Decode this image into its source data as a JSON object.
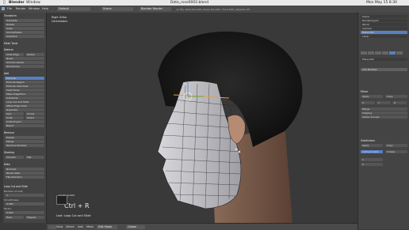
{
  "mac_menu": {
    "apple": "",
    "app": "Blender",
    "window": "Window",
    "title": "Data_rose0002.blend",
    "clock": "Mon May 15  8:30"
  },
  "header": {
    "menus": [
      "File",
      "Render",
      "Window",
      "Help"
    ],
    "layout": "Default",
    "scene": "Scene",
    "engine": "Blender Render",
    "stats": "v2.78 | Verts:9/1,428 | Faces:0/1,420 | Tris:2,840 | Objects:1/5"
  },
  "tool_shelf": {
    "sections": [
      {
        "heading": "Transform",
        "items": [
          "Translate",
          "Rotate",
          "Scale",
          "Shrink/Fatten",
          "Push/Pull"
        ]
      },
      {
        "heading": "Mesh Tools",
        "items": []
      },
      {
        "heading": "Deform",
        "items": [
          "Slide Edge",
          "Vertex",
          "Noise",
          "Smooth Vertex",
          "Randomize"
        ]
      },
      {
        "heading": "Add",
        "items": [
          "Extrude",
          "Extrude Region",
          "Extrude Individual",
          "Inset Faces",
          "Make Edge/Face",
          "Subdivide",
          "Loop Cut and Slide",
          "Offset Edge Slide",
          "Duplicate",
          "Spin",
          "Screw",
          "Knife",
          "Select",
          "Knife Project",
          "Bisect"
        ]
      },
      {
        "heading": "Remove",
        "items": [
          "Delete",
          "Merge",
          "Remove Doubles"
        ]
      },
      {
        "heading": "Shading",
        "items": [
          "Smooth",
          "Flat"
        ]
      },
      {
        "heading": "Data",
        "items": [
          "Normals",
          "Recalculate",
          "Flip Direction"
        ]
      },
      {
        "heading": "Loop Cut and Slide",
        "items": [
          "Number of Cuts",
          "Smoothness",
          "Factor",
          "Even",
          "Flipped"
        ]
      }
    ],
    "operator_values": {
      "cuts": "1",
      "smoothness": "0.000",
      "factor": "0.000"
    }
  },
  "viewport": {
    "view_label": "Right Ortho",
    "unit_label": "Centimeters",
    "object_label": "(1) Plane.002",
    "key_hint": "Ctrl + R",
    "last_op": "Last: Loop Cut and Slide"
  },
  "bottom_bar": {
    "items": [
      "View",
      "Select",
      "Add",
      "Mesh"
    ],
    "mode": "Edit Mode",
    "pivot": "Global"
  },
  "outliner": {
    "items": [
      "Scene",
      "RenderLayers",
      "World",
      "Camera",
      "Plane.002",
      "Lamp"
    ]
  },
  "properties": {
    "tabs": [
      "Render",
      "Scene",
      "World",
      "Object",
      "Modifiers",
      "Data"
    ],
    "object_name": "Plane.002",
    "add_modifier": "Add Modifier",
    "modifiers": [
      {
        "name": "Mirror",
        "apply": "Apply",
        "copy": "Copy",
        "axis": [
          "X",
          "Y",
          "Z"
        ],
        "options": [
          "Merge",
          "Clipping",
          "Vertex Groups"
        ]
      },
      {
        "name": "Subdivision",
        "apply": "Apply",
        "copy": "Copy",
        "mode": [
          "Catmull-Clark",
          "Simple"
        ],
        "view": "1",
        "render": "2"
      }
    ]
  },
  "colors": {
    "accent": "#5680c2",
    "active": "#e6a23c",
    "panel": "#444444",
    "viewport": "#393939"
  }
}
